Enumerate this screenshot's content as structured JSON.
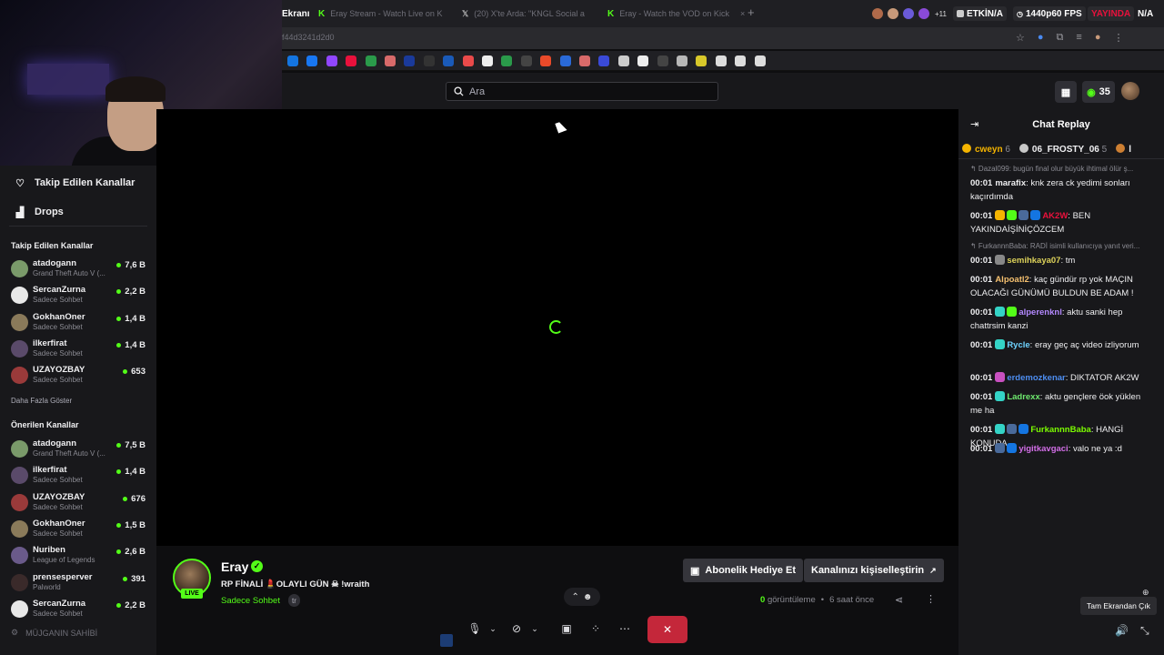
{
  "tabs": [
    {
      "label": "Ekranı",
      "active": true
    },
    {
      "label": "Eray Stream - Watch Live on K"
    },
    {
      "label": "(20) X'te Arda: \"KNGL Social a"
    },
    {
      "label": "Eray - Watch the VOD on Kick"
    }
  ],
  "tab_new": "+",
  "tab_close": "×",
  "browser_badges": {
    "extra_avatars": "+11",
    "live_label": "ETKİN/A",
    "fps": "1440p60 FPS",
    "yayinda": "YAYINDA",
    "nva": "N/A"
  },
  "url": "f44d3241d2d0",
  "search": {
    "placeholder": "Ara"
  },
  "header": {
    "points": "35"
  },
  "sidebar": {
    "nav": [
      {
        "label": "Takip Edilen Kanallar",
        "icon": "heart-icon"
      },
      {
        "label": "Drops",
        "icon": "drops-icon"
      }
    ],
    "followed_title": "Takip Edilen Kanallar",
    "followed": [
      {
        "name": "atadogann",
        "game": "Grand Theft Auto V (...",
        "viewers": "7,6 B",
        "color": "#7a9a6a"
      },
      {
        "name": "SercanZurna",
        "game": "Sadece Sohbet",
        "viewers": "2,2 B",
        "color": "#e8e8e8"
      },
      {
        "name": "GokhanOner",
        "game": "Sadece Sohbet",
        "viewers": "1,4 B",
        "color": "#8a7a5a"
      },
      {
        "name": "ilkerfirat",
        "game": "Sadece Sohbet",
        "viewers": "1,4 B",
        "color": "#5a4a6a"
      },
      {
        "name": "UZAYOZBAY",
        "game": "Sadece Sohbet",
        "viewers": "653",
        "color": "#9a3a3a"
      }
    ],
    "show_more": "Daha Fazla Göster",
    "recommended_title": "Önerilen Kanallar",
    "recommended": [
      {
        "name": "atadogann",
        "game": "Grand Theft Auto V (...",
        "viewers": "7,5 B",
        "color": "#7a9a6a"
      },
      {
        "name": "ilkerfirat",
        "game": "Sadece Sohbet",
        "viewers": "1,4 B",
        "color": "#5a4a6a"
      },
      {
        "name": "UZAYOZBAY",
        "game": "Sadece Sohbet",
        "viewers": "676",
        "color": "#9a3a3a"
      },
      {
        "name": "GokhanOner",
        "game": "Sadece Sohbet",
        "viewers": "1,5 B",
        "color": "#8a7a5a"
      },
      {
        "name": "Nuriben",
        "game": "League of Legends",
        "viewers": "2,6 B",
        "color": "#6a5a8a"
      },
      {
        "name": "prensesperver",
        "game": "Palworld",
        "viewers": "391",
        "color": "#3a2a2a"
      },
      {
        "name": "SercanZurna",
        "game": "Sadece Sohbet",
        "viewers": "2,2 B",
        "color": "#e8e8e8"
      }
    ],
    "bottom_text": "MÜJGANIN SAHİBİ"
  },
  "stream": {
    "name": "Eray",
    "live_badge": "LIVE",
    "verified_icon": "✓",
    "title": "RP FİNALİ 💄OLAYLI GÜN ☠ !wraith",
    "category": "Sadece Sohbet",
    "lang": "tr",
    "gift_btn": "Abonelik Hediye Et",
    "customize_btn": "Kanalınızı kişiselleştirin",
    "views_count": "0",
    "views_label": "görüntüleme",
    "bullet": "•",
    "time_ago": "6 saat önce"
  },
  "chat": {
    "title": "Chat Replay",
    "gifters": [
      {
        "rank": "1",
        "name": "cweyn",
        "count": "6",
        "color": "#f5b400"
      },
      {
        "rank": "2",
        "name": "06_FROSTY_06",
        "count": "5",
        "color": "#c8c8c8"
      },
      {
        "rank": "3",
        "name": "l",
        "count": "",
        "color": "#cd7f32"
      }
    ],
    "messages": [
      {
        "reply": "↰ Dazal099: bugün final olur büyük ihtimal ölür ş...",
        "time": "00:01",
        "user": "marafix",
        "user_color": "#efeff1",
        "text": ": knk zera ck yedimi sonları kaçırdımda",
        "badges": []
      },
      {
        "reply": "",
        "time": "00:01",
        "user": "AK2W",
        "user_color": "#e9113c",
        "text": ": BEN YAKINDAİŞİNİÇÖZCEM",
        "badges": [
          "#f5b400",
          "#53fc18",
          "#4a6a9a",
          "#1475e1"
        ]
      },
      {
        "reply": "↰ FurkannnBaba: RADİ isimli kullanıcıya yanıt veri...",
        "time": "00:01",
        "user": "semihkaya07",
        "user_color": "#ddd25a",
        "text": ": tm",
        "badges": [
          "#888"
        ]
      },
      {
        "reply": "",
        "time": "00:01",
        "user": "Alpoatl2",
        "user_color": "#f5c06f",
        "text": ": kaç gündür rp yok MAÇIN OLACAĞI GÜNÜMÜ BULDUN BE ADAM !",
        "badges": []
      },
      {
        "reply": "",
        "time": "00:01",
        "user": "alperenknl",
        "user_color": "#b388ff",
        "text": ": aktu sanki hep chattrsim kanzi",
        "badges": [
          "#34d3c6",
          "#53fc18"
        ]
      },
      {
        "reply": "",
        "time": "00:01",
        "user": "Rycle",
        "user_color": "#6ed3ff",
        "text": ": eray geç aç video izliyorum",
        "badges": [
          "#34d3c6"
        ]
      },
      {
        "reply": "",
        "time": "00:01",
        "user": "erdemozkenar",
        "user_color": "#4d8df0",
        "text": ": DIKTATOR AK2W",
        "badges": [
          "#c850c0"
        ]
      },
      {
        "reply": "",
        "time": "00:01",
        "user": "Ladrexx",
        "user_color": "#6ee86e",
        "text": ": aktu gençlere öok yüklen me ha",
        "badges": [
          "#34d3c6"
        ]
      },
      {
        "reply": "",
        "time": "00:01",
        "user": "FurkannnBaba",
        "user_color": "#7cfc00",
        "text": ": HANGİ KONUDA",
        "badges": [
          "#34d3c6",
          "#4a6a9a",
          "#1475e1"
        ]
      },
      {
        "reply": "",
        "time": "00:01",
        "user": "yigitkavgaci",
        "user_color": "#d36ee8",
        "text": ": valo ne ya :d",
        "badges": [
          "#4a6a9a",
          "#1475e1"
        ]
      }
    ]
  },
  "tooltip": "Tam Ekrandan Çık",
  "colors": {
    "accent": "#53fc18",
    "bg": "#0e0e10",
    "panel": "#18181b",
    "end_call": "#c4273a"
  }
}
